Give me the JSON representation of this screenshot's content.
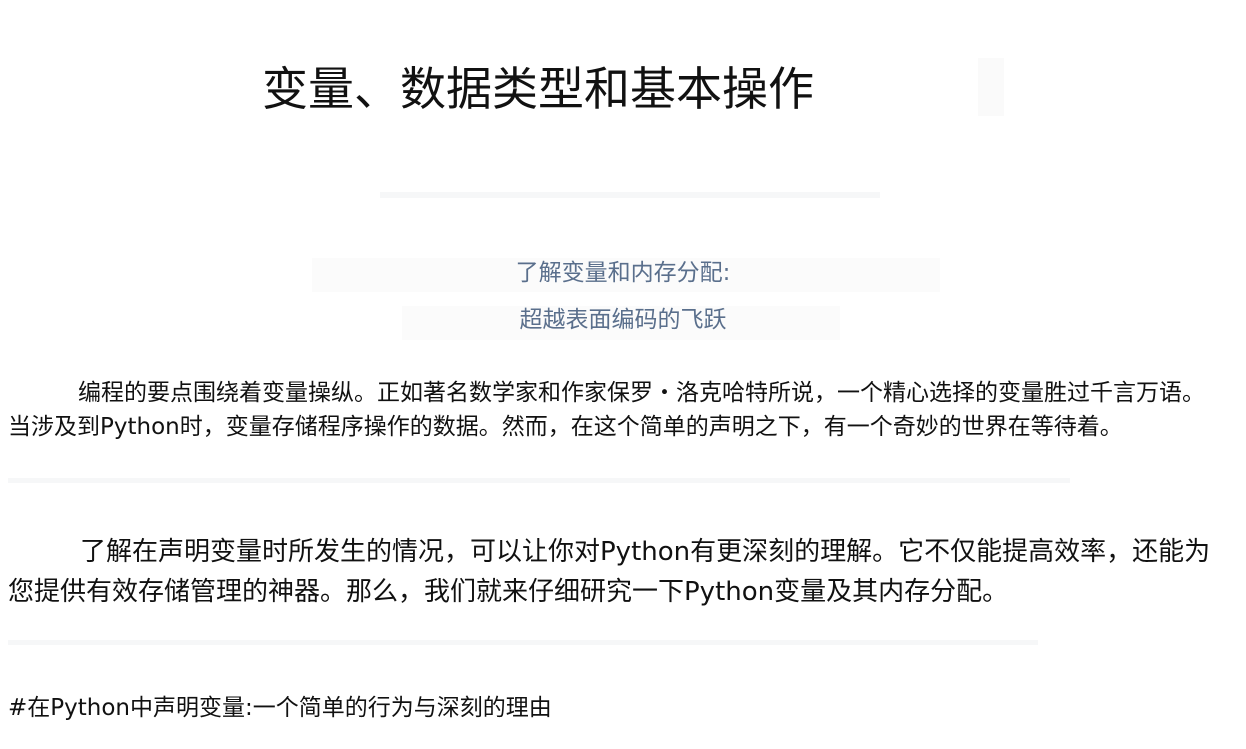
{
  "title": "变量、数据类型和基本操作",
  "subtitle": {
    "line1": "了解变量和内存分配:",
    "line2": "超越表面编码的飞跃"
  },
  "paragraphs": [
    "编程的要点围绕着变量操纵。正如著名数学家和作家保罗・洛克哈特所说，一个精心选择的变量胜过千言万语。当涉及到Python时，变量存储程序操作的数据。然而，在这个简单的声明之下，有一个奇妙的世界在等待着。",
    "了解在声明变量时所发生的情况，可以让你对Python有更深刻的理解。它不仅能提高效率，还能为您提供有效存储管理的神器。那么，我们就来仔细研究一下Python变量及其内存分配。"
  ],
  "section_heading": "#在Python中声明变量:一个简单的行为与深刻的理由"
}
